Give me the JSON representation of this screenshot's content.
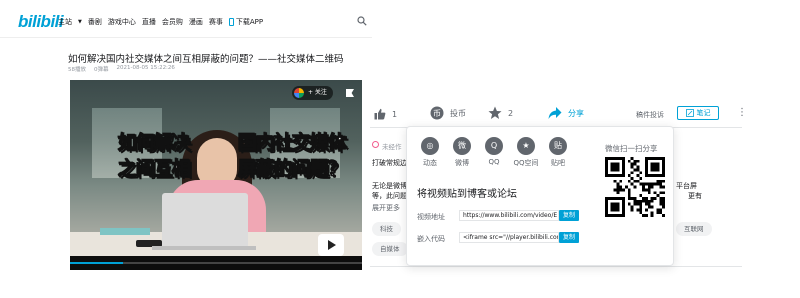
{
  "header": {
    "logo": "bilibili",
    "nav": [
      "主站",
      "番剧",
      "游戏中心",
      "直播",
      "会员购",
      "漫画",
      "赛事",
      "下载APP"
    ]
  },
  "video": {
    "title": "如何解决国内社交媒体之间互相屏蔽的问题？——社交媒体二维码",
    "views": "58播放",
    "danmaku": "0弹幕",
    "date": "2021-08-05 15:22:26",
    "overlay_line1_a": "如何解决",
    "overlay_line1_b": "国内社交媒体",
    "overlay_line2_a": "之间互相",
    "overlay_line2_b": "屏蔽的问题？",
    "follow_label": "+ 关注",
    "progress": 0.18
  },
  "toolbar": {
    "like_count": "1",
    "coin_label": "投币",
    "collect_count": "2",
    "share_label": "分享",
    "report_label": "稿件投诉",
    "notes_label": "笔记"
  },
  "page": {
    "unauthorized": "未经作",
    "desc_line1": "打破常规边",
    "desc_line2": "无论是微博",
    "desc_line3": "等，此问题",
    "expand": "展开更多",
    "right_frag1": "平台屏",
    "right_frag2": "更有",
    "tags": [
      "科技",
      "自媒体",
      "互联网"
    ]
  },
  "share_popup": {
    "platforms": [
      {
        "label": "动态",
        "icon": "dynamic-icon"
      },
      {
        "label": "微博",
        "icon": "weibo-icon"
      },
      {
        "label": "QQ",
        "icon": "qq-icon"
      },
      {
        "label": "QQ空间",
        "icon": "qzone-icon"
      },
      {
        "label": "贴吧",
        "icon": "tieba-icon"
      }
    ],
    "embed_title": "将视频贴到博客或论坛",
    "video_url_label": "视频地址",
    "video_url": "https://www.bilibili.com/video/E",
    "embed_code_label": "嵌入代码",
    "embed_code": "<iframe src=\"//player.bilibili.com",
    "copy_label": "复制",
    "qr_title": "微信扫一扫分享"
  },
  "colors": {
    "accent": "#00a1d6",
    "text": "#18191c",
    "muted": "#61666d"
  }
}
